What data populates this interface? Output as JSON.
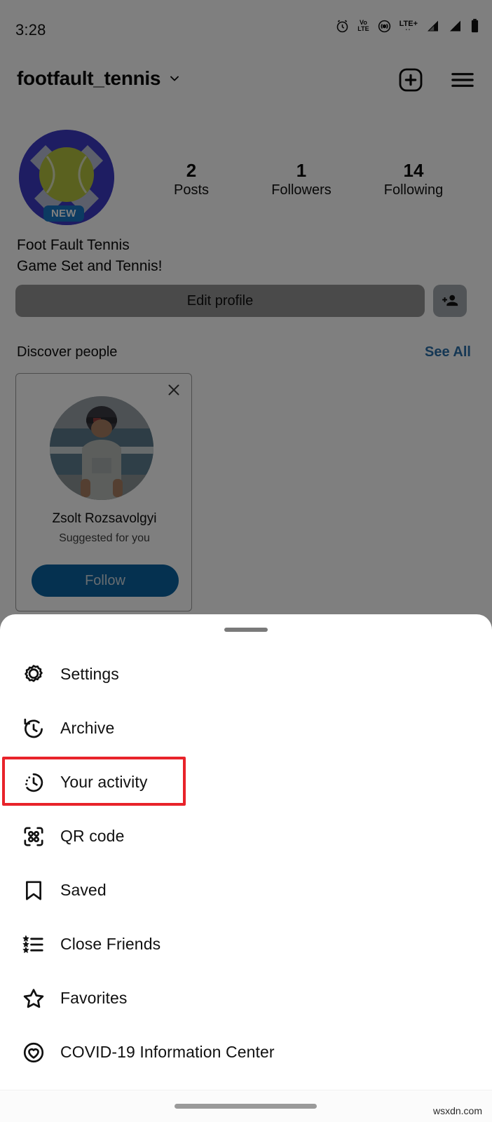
{
  "status_bar": {
    "time": "3:28",
    "icons": [
      "alarm-icon",
      "volte-icon",
      "hotspot-icon",
      "lte-plus-icon",
      "signal-1-icon",
      "signal-2-icon",
      "battery-icon"
    ],
    "volte_top": "Vo",
    "volte_bottom": "LTE",
    "lte_label": "LTE+"
  },
  "header": {
    "username": "footfault_tennis",
    "chevron": "chevron-down-icon",
    "add_icon": "plus-square-icon",
    "menu_icon": "hamburger-menu-icon"
  },
  "profile": {
    "avatar_alt": "profile-avatar",
    "new_badge": "NEW",
    "stats": [
      {
        "number": "2",
        "label": "Posts"
      },
      {
        "number": "1",
        "label": "Followers"
      },
      {
        "number": "14",
        "label": "Following"
      }
    ],
    "display_name": "Foot Fault Tennis",
    "bio": "Game Set and Tennis!",
    "edit_profile_label": "Edit profile",
    "add_person_icon": "add-person-icon"
  },
  "discover": {
    "title": "Discover people",
    "see_all": "See All",
    "card": {
      "close_icon": "close-icon",
      "name": "Zsolt Rozsavolgyi",
      "subtitle": "Suggested for you",
      "follow_label": "Follow"
    }
  },
  "sheet": {
    "handle": "drag-handle",
    "menu": [
      {
        "label": "Settings",
        "icon": "gear-icon",
        "highlighted": false
      },
      {
        "label": "Archive",
        "icon": "archive-clock-icon",
        "highlighted": false
      },
      {
        "label": "Your activity",
        "icon": "your-activity-clock-icon",
        "highlighted": true
      },
      {
        "label": "QR code",
        "icon": "qr-code-icon",
        "highlighted": false
      },
      {
        "label": "Saved",
        "icon": "bookmark-icon",
        "highlighted": false
      },
      {
        "label": "Close Friends",
        "icon": "close-friends-list-icon",
        "highlighted": false
      },
      {
        "label": "Favorites",
        "icon": "star-icon",
        "highlighted": false
      },
      {
        "label": "COVID-19 Information Center",
        "icon": "covid-heart-icon",
        "highlighted": false
      }
    ]
  },
  "footer": {
    "home_indicator": "home-indicator",
    "watermark": "wsxdn.com"
  },
  "colors": {
    "accent_blue": "#0a62a0",
    "link_blue": "#2b6fa8",
    "badge_blue": "#1877c4",
    "highlight_red": "#e8232a",
    "avatar_blue": "#3d3bc4",
    "tennis_ball": "#b5c33f"
  }
}
